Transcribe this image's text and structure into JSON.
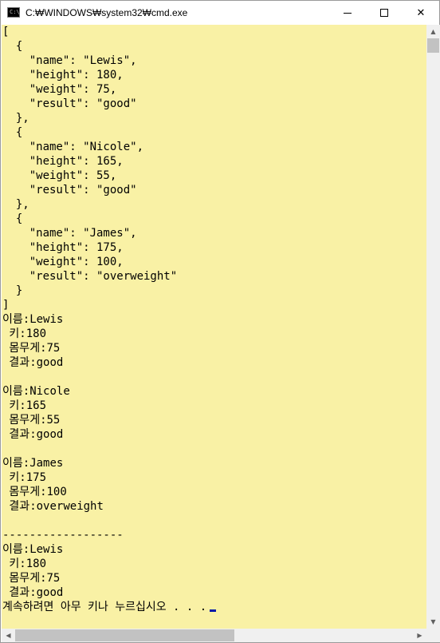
{
  "window": {
    "title": "C:₩WINDOWS₩system32₩cmd.exe",
    "icon": "cmd-icon",
    "prompt_glyph": "C:\\",
    "buttons": {
      "minimize": "minimize-icon",
      "maximize": "maximize-icon",
      "close_label": "✕"
    }
  },
  "console": {
    "background": "#f9f1a5",
    "lines": [
      "[",
      "  {",
      "    \"name\": \"Lewis\",",
      "    \"height\": 180,",
      "    \"weight\": 75,",
      "    \"result\": \"good\"",
      "  },",
      "  {",
      "    \"name\": \"Nicole\",",
      "    \"height\": 165,",
      "    \"weight\": 55,",
      "    \"result\": \"good\"",
      "  },",
      "  {",
      "    \"name\": \"James\",",
      "    \"height\": 175,",
      "    \"weight\": 100,",
      "    \"result\": \"overweight\"",
      "  }",
      "]",
      "이름:Lewis",
      " 키:180",
      " 몸무게:75",
      " 결과:good",
      "",
      "이름:Nicole",
      " 키:165",
      " 몸무게:55",
      " 결과:good",
      "",
      "이름:James",
      " 키:175",
      " 몸무게:100",
      " 결과:overweight",
      "",
      "------------------",
      "이름:Lewis",
      " 키:180",
      " 몸무게:75",
      " 결과:good"
    ],
    "prompt": "계속하려면 아무 키나 누르십시오 . . .",
    "cursor_color": "#0018a8"
  },
  "scrollbars": {
    "up_arrow": "▲",
    "down_arrow": "▼",
    "left_arrow": "◀",
    "right_arrow": "▶"
  }
}
